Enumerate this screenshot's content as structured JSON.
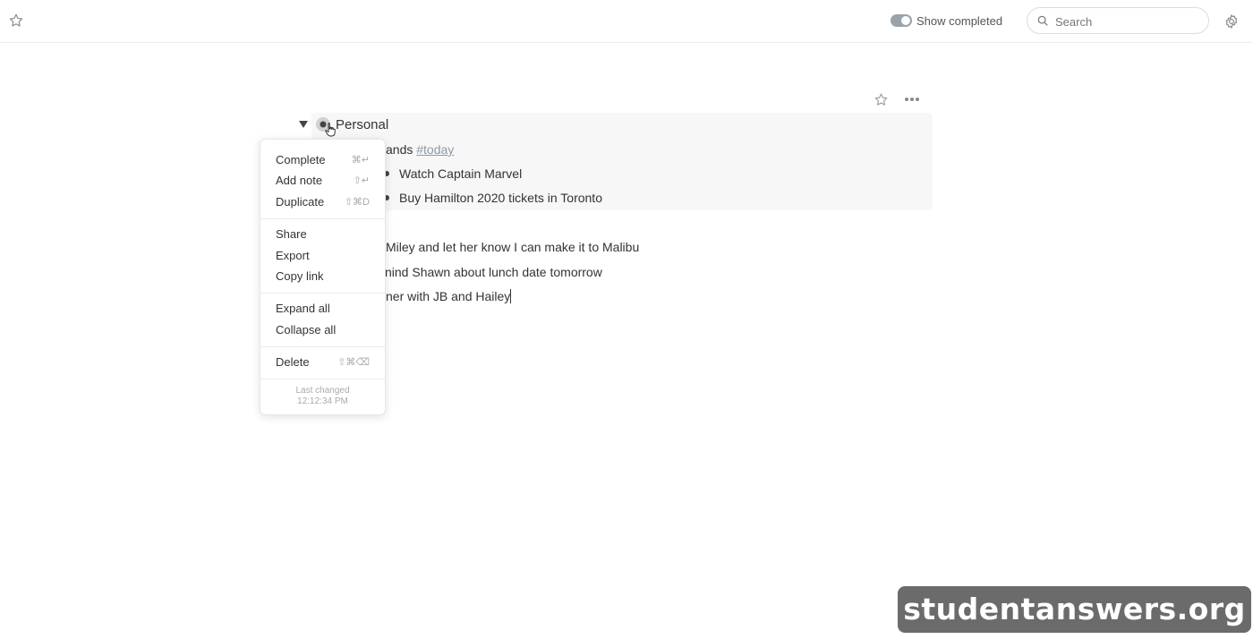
{
  "topbar": {
    "show_completed_label": "Show completed",
    "show_completed_on": true,
    "search_placeholder": "Search"
  },
  "document": {
    "title": "Personal",
    "items": [
      {
        "text": "Errands ",
        "tag": "#today",
        "visible_text": "ands "
      },
      {
        "text": "Watch Captain Marvel"
      },
      {
        "text": "Buy Hamilton 2020 tickets in Toronto"
      },
      {
        "text": "Call Miley and let her know I can make it to Malibu",
        "visible_text": "l Miley and let her know I can make it to Malibu"
      },
      {
        "text": "Remind Shawn about lunch date tomorrow",
        "visible_text": "nind Shawn about lunch date tomorrow"
      },
      {
        "text": "Dinner with JB and Hailey",
        "visible_text": "ner with JB and Hailey"
      }
    ]
  },
  "context_menu": {
    "groups": [
      [
        {
          "label": "Complete",
          "shortcut": "⌘↵"
        },
        {
          "label": "Add note",
          "shortcut": "⇧↵"
        },
        {
          "label": "Duplicate",
          "shortcut": "⇧⌘D"
        }
      ],
      [
        {
          "label": "Share",
          "shortcut": ""
        },
        {
          "label": "Export",
          "shortcut": ""
        },
        {
          "label": "Copy link",
          "shortcut": ""
        }
      ],
      [
        {
          "label": "Expand all",
          "shortcut": ""
        },
        {
          "label": "Collapse all",
          "shortcut": ""
        }
      ],
      [
        {
          "label": "Delete",
          "shortcut": "⇧⌘⌫"
        }
      ]
    ],
    "footer_label": "Last changed",
    "footer_time": "12:12:34 PM"
  },
  "watermark": "studentanswers.org",
  "icons": {
    "top_left": "star-icon",
    "settings": "gear-icon",
    "search": "search-icon",
    "doc_star": "star-icon",
    "doc_more": "more-horizontal-icon"
  },
  "colors": {
    "toggle": "#9aa2aa",
    "tag": "#8f9aa4",
    "card_bg": "#f7f7f8"
  }
}
